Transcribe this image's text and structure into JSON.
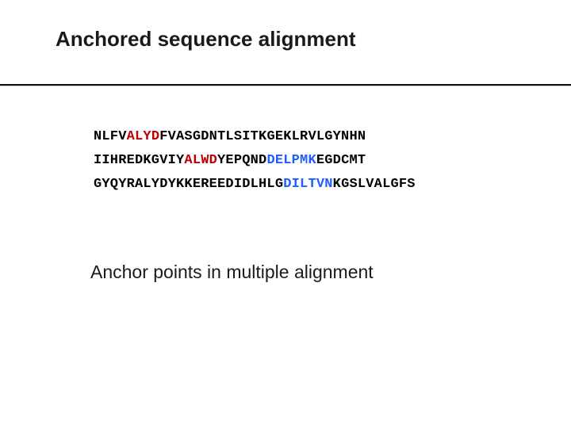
{
  "title": "Anchored sequence alignment",
  "subtitle": "Anchor points in multiple alignment",
  "sequences": {
    "row1": {
      "a": "NLFV",
      "b_red": "ALYD",
      "c": "FVASGDNTLSITKGEKLRVLGYNHN"
    },
    "row2": {
      "a": "IIHREDKGVIY",
      "b_red": "ALWD",
      "c": "YEPQND",
      "d_blue": "DELPMK",
      "e": "EGDCMT"
    },
    "row3": {
      "a": "GYQYRALYDYKKEREEDIDLHLG",
      "b_blue": "DILTVN",
      "c": "KGSLVALGFS"
    }
  }
}
